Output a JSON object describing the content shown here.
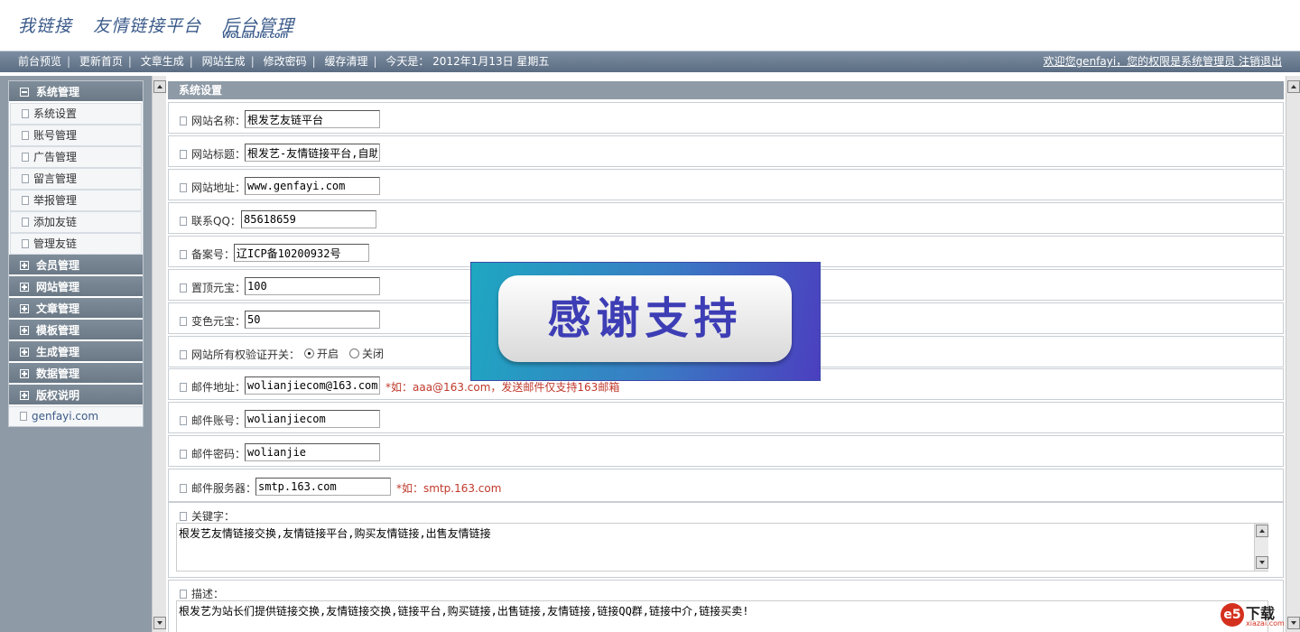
{
  "header": {
    "logo_parts": [
      "我链接",
      "友情链接平台",
      "后台管理"
    ],
    "logo_sub": "WoLianJie.com"
  },
  "nav": {
    "items": [
      "前台预览",
      "更新首页",
      "文章生成",
      "网站生成",
      "修改密码",
      "缓存清理"
    ],
    "date_label": "今天是： 2012年1月13日 星期五",
    "welcome": "欢迎您genfayi，您的权限是系统管理员 注销退出"
  },
  "sidebar": {
    "active_group": "系统管理",
    "sub_items": [
      "系统设置",
      "账号管理",
      "广告管理",
      "留言管理",
      "举报管理",
      "添加友链",
      "管理友链"
    ],
    "groups": [
      "会员管理",
      "网站管理",
      "文章管理",
      "模板管理",
      "生成管理",
      "数据管理",
      "版权说明"
    ],
    "footer": "genfayi.com"
  },
  "panel": {
    "title": "系统设置",
    "site_name": {
      "label": "网站名称：",
      "value": "根发艺友链平台"
    },
    "site_title": {
      "label": "网站标题：",
      "value": "根发艺-友情链接平台,自助"
    },
    "site_url": {
      "label": "网站地址：",
      "value": "www.genfayi.com"
    },
    "qq": {
      "label": "联系QQ：",
      "value": "85618659"
    },
    "icp": {
      "label": "备案号：",
      "value": "辽ICP备10200932号"
    },
    "top_coin": {
      "label": "置顶元宝：",
      "value": "100"
    },
    "color_coin": {
      "label": "变色元宝：",
      "value": "50"
    },
    "verify": {
      "label": "网站所有权验证开关：",
      "on": "开启",
      "off": "关闭"
    },
    "mail_addr": {
      "label": "邮件地址：",
      "value": "wolianjiecom@163.com",
      "hint": "*如：aaa@163.com，发送邮件仅支持163邮箱"
    },
    "mail_user": {
      "label": "邮件账号：",
      "value": "wolianjiecom"
    },
    "mail_pass": {
      "label": "邮件密码：",
      "value": "wolianjie"
    },
    "mail_server": {
      "label": "邮件服务器：",
      "value": "smtp.163.com",
      "hint": "*如：smtp.163.com"
    },
    "keywords": {
      "label": "关键字：",
      "value": "根发艺友情链接交换,友情链接平台,购买友情链接,出售友情链接"
    },
    "description": {
      "label": "描述：",
      "value": "根发艺为站长们提供链接交换,友情链接交换,链接平台,购买链接,出售链接,友情链接,链接QQ群,链接中介,链接买卖!"
    }
  },
  "overlay": {
    "text": "感谢支持"
  },
  "watermark": {
    "circle": "e5",
    "text": "下载",
    "sub": "xiazai.com"
  }
}
